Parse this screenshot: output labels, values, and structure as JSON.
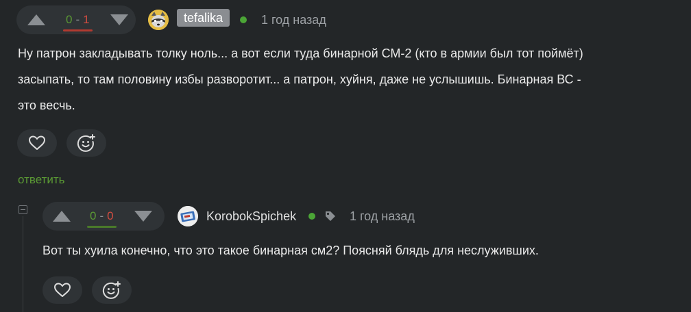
{
  "comment1": {
    "rating": {
      "plus": "0",
      "minus": "1",
      "separator": "-"
    },
    "author": "tefalika",
    "time": "1 год назад",
    "text_lines": [
      "Ну патрон закладывать толку ноль... а вот если туда бинарной СМ-2 (кто в армии был тот поймёт)",
      "засыпать, то там половину избы разворотит... а патрон, хуйня, даже не услышишь. Бинарная ВС -",
      "это весчь."
    ],
    "reply_label": "ответить"
  },
  "comment2": {
    "rating": {
      "plus": "0",
      "minus": "0",
      "separator": "-"
    },
    "author": "KorobokSpichek",
    "time": "1 год назад",
    "text_lines": [
      "Вот ты хуила конечно, что это такое бинарная см2? Поясняй блядь для неслуживших."
    ]
  },
  "colors": {
    "background": "#232628",
    "panel": "#2f3336",
    "accent_green": "#5b9a34",
    "accent_red": "#d24d41",
    "online": "#4ba536"
  },
  "icons": [
    "upvote-arrow-icon",
    "downvote-arrow-icon",
    "heart-icon",
    "emoji-add-icon",
    "tag-icon",
    "online-dot-icon"
  ]
}
